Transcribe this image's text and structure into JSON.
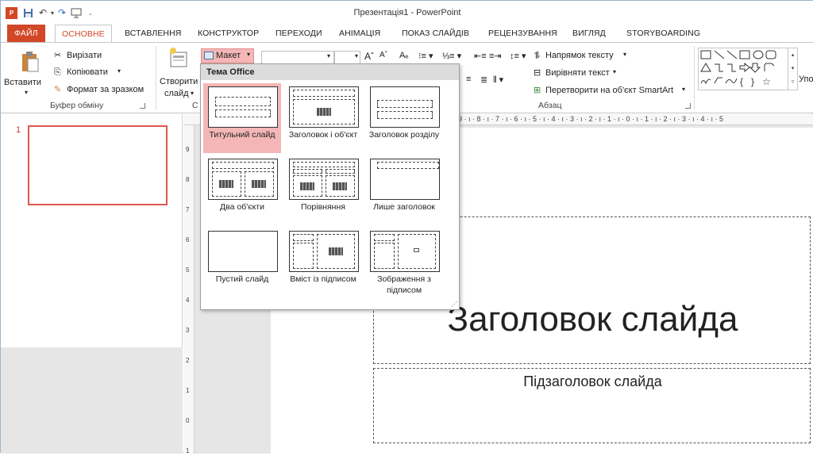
{
  "window": {
    "title": "Презентація1 - PowerPoint"
  },
  "qat": {
    "icons": [
      "powerpoint-logo-icon",
      "save-icon",
      "undo-icon",
      "redo-icon",
      "start-slideshow-icon",
      "customize-qat-icon"
    ]
  },
  "tabs": [
    {
      "label": "ФАЙЛ"
    },
    {
      "label": "ОСНОВНЕ"
    },
    {
      "label": "ВСТАВЛЕННЯ"
    },
    {
      "label": "КОНСТРУКТОР"
    },
    {
      "label": "ПЕРЕХОДИ"
    },
    {
      "label": "АНІМАЦІЯ"
    },
    {
      "label": "ПОКАЗ СЛАЙДІВ"
    },
    {
      "label": "РЕЦЕНЗУВАННЯ"
    },
    {
      "label": "ВИГЛЯД"
    },
    {
      "label": "STORYBOARDING"
    }
  ],
  "ribbon": {
    "clipboard": {
      "paste": "Вставити",
      "cut": "Вирізати",
      "copy": "Копіювати",
      "format_painter": "Формат за зразком",
      "group_label": "Буфер обміну"
    },
    "slides": {
      "new_slide_1": "Створити",
      "new_slide_2": "слайд",
      "layout": "Макет",
      "group_label_partial": "С"
    },
    "paragraph": {
      "text_direction": "Напрямок тексту",
      "align_text": "Вирівняти текст",
      "convert_smartart": "Перетворити на об'єкт SmartArt",
      "group_label": "Абзац"
    },
    "drawing": {
      "partial_label": "Упо"
    }
  },
  "ruler": {
    "h_ticks": "9 · ı · 8 · ı · 7 · ı · 6 · ı · 5 · ı · 4 · ı · 3 · ı · 2 · ı · 1 · ı · 0 · ı · 1 · ı · 2 · ı · 3 · ı · 4 · ı · 5"
  },
  "thumbnails": [
    {
      "number": "1"
    }
  ],
  "gallery": {
    "header": "Тема Office",
    "layouts": [
      {
        "label": "Титульний слайд",
        "selected": true
      },
      {
        "label": "Заголовок і об'єкт"
      },
      {
        "label": "Заголовок розділу"
      },
      {
        "label": "Два об'єкти"
      },
      {
        "label": "Порівняння"
      },
      {
        "label": "Лише заголовок"
      },
      {
        "label": "Пустий слайд"
      },
      {
        "label": "Вміст із підписом"
      },
      {
        "label": "Зображення з підписом"
      }
    ]
  },
  "slide": {
    "title": "Заголовок слайда",
    "subtitle": "Підзаголовок слайда"
  },
  "colors": {
    "accent": "#d24726",
    "selected_layout": "#f4b6b6",
    "selected_thumb_border": "#e0574f"
  }
}
